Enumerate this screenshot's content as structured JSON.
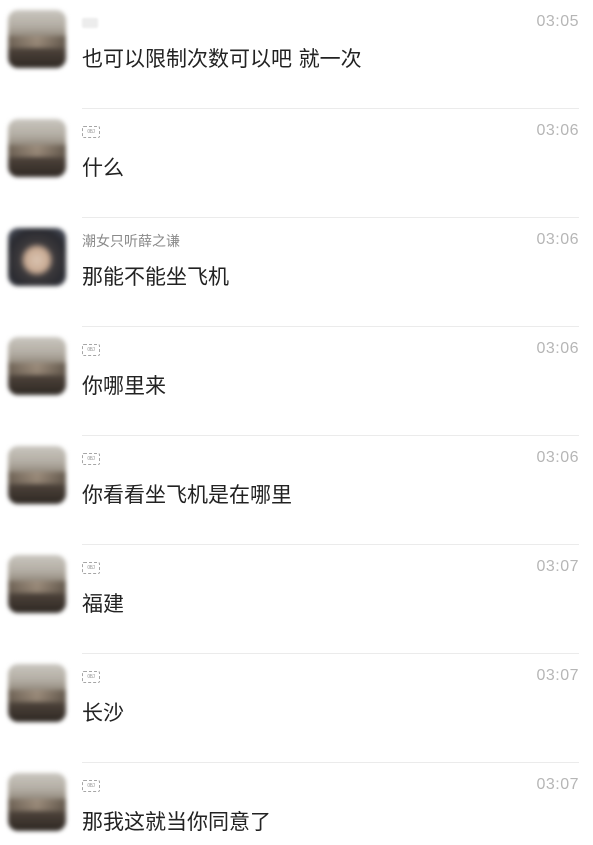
{
  "messages": [
    {
      "nickname": "",
      "nickname_style": "blank",
      "avatar": "blurred-landscape",
      "time": "03:05",
      "text": "也可以限制次数可以吧  就一次"
    },
    {
      "nickname": "OBJ",
      "nickname_style": "placeholder-box",
      "avatar": "blurred-landscape",
      "time": "03:06",
      "text": "什么"
    },
    {
      "nickname": "潮女只听薛之谦",
      "nickname_style": "text",
      "avatar": "blurred-person",
      "time": "03:06",
      "text": "那能不能坐飞机"
    },
    {
      "nickname": "OBJ",
      "nickname_style": "placeholder-box",
      "avatar": "blurred-landscape",
      "time": "03:06",
      "text": "你哪里来"
    },
    {
      "nickname": "OBJ",
      "nickname_style": "placeholder-box",
      "avatar": "blurred-landscape",
      "time": "03:06",
      "text": "你看看坐飞机是在哪里"
    },
    {
      "nickname": "OBJ",
      "nickname_style": "placeholder-box",
      "avatar": "blurred-landscape",
      "time": "03:07",
      "text": "福建"
    },
    {
      "nickname": "OBJ",
      "nickname_style": "placeholder-box",
      "avatar": "blurred-landscape",
      "time": "03:07",
      "text": "长沙"
    },
    {
      "nickname": "OBJ",
      "nickname_style": "placeholder-box",
      "avatar": "blurred-landscape",
      "time": "03:07",
      "text": "那我这就当你同意了"
    }
  ]
}
